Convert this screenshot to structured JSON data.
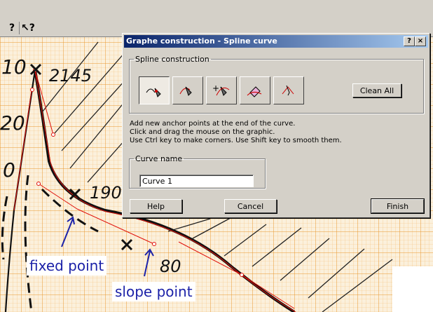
{
  "toolbar": {
    "help_icon": "question-mark-icon",
    "whatsthis_icon": "whats-this-pointer-icon"
  },
  "background_labels": {
    "label_10": "10",
    "label_2145": "2145",
    "label_20": "20",
    "label_0": "0",
    "label_190": "190",
    "label_80": "80"
  },
  "annotations": {
    "fixed_point": "fixed point",
    "slope_point": "slope point"
  },
  "dialog": {
    "title": "Graphe construction - Spline curve",
    "title_buttons": {
      "help": "?",
      "close": "×"
    },
    "group_spline": {
      "legend": "Spline construction",
      "tools": [
        {
          "name": "add-anchor-end-tool",
          "active": true
        },
        {
          "name": "insert-anchor-tool",
          "active": false
        },
        {
          "name": "add-anchor-plus-tool",
          "active": false
        },
        {
          "name": "erase-tool",
          "active": false
        },
        {
          "name": "move-anchor-tool",
          "active": false
        }
      ],
      "clear_all": "Clean All"
    },
    "instructions": [
      "Add new anchor points at the end of the curve.",
      "Click and drag the mouse on the graphic.",
      "Use Ctrl key to make corners. Use Shift key to smooth them."
    ],
    "group_name": {
      "legend": "Curve name",
      "value": "Curve 1"
    },
    "buttons": {
      "help": "Help",
      "cancel": "Cancel",
      "finish": "Finish"
    }
  },
  "colors": {
    "grid_minor": "#f5c27a",
    "grid_major": "#e8982e",
    "spline": "#e0100a",
    "curve": "#1a1a1a",
    "annotation_text": "#1c22a8",
    "dialog_title": "#0a246a"
  }
}
